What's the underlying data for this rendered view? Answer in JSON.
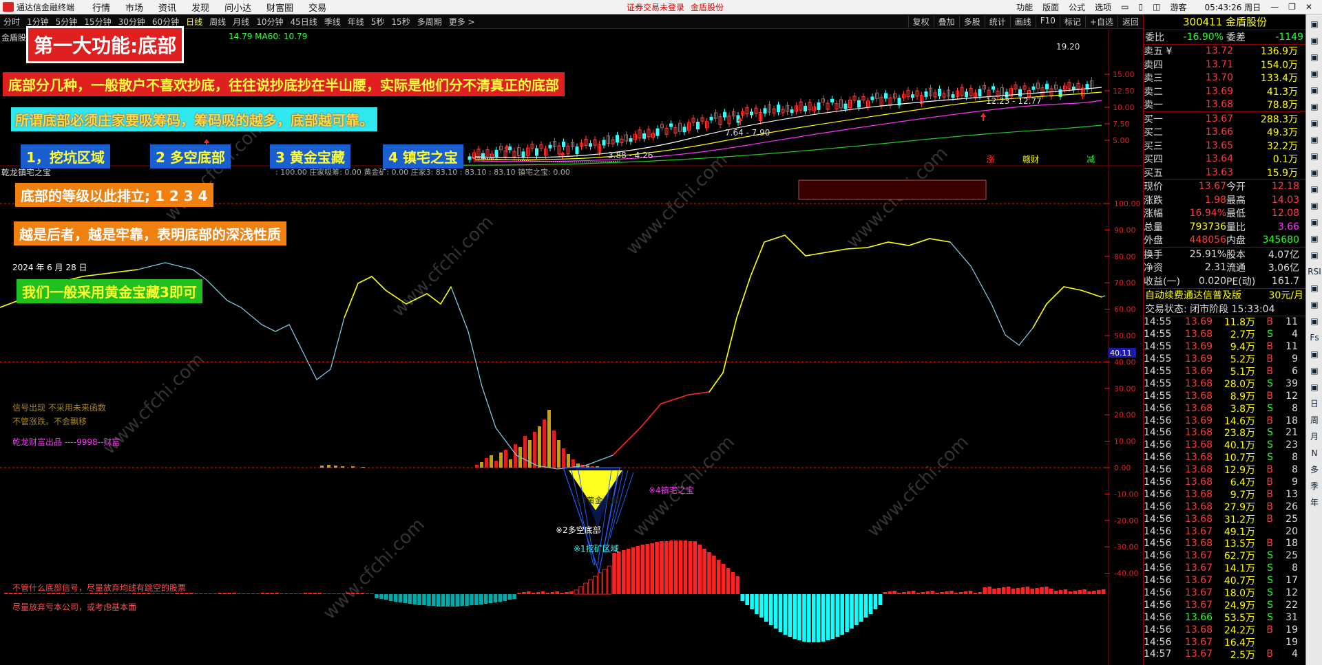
{
  "app": {
    "title": "通达信金融终端",
    "menus": [
      "行情",
      "市场",
      "资讯",
      "发现",
      "问小达",
      "财富圈",
      "交易"
    ],
    "warning": "证券交易未登录",
    "stock_tab": "金盾股份",
    "right_menu": [
      "功能",
      "版面",
      "公式",
      "选项"
    ],
    "user": "游客",
    "clock": "05:43:26 周日"
  },
  "periods": [
    "分时",
    "1分钟",
    "5分钟",
    "15分钟",
    "30分钟",
    "60分钟",
    "日线",
    "周线",
    "月线",
    "10分钟",
    "45日线",
    "季线",
    "年线",
    "5秒",
    "15秒",
    "多周期",
    "更多 >"
  ],
  "active_period": "日线",
  "tools": [
    "复权",
    "叠加",
    "多股",
    "统计",
    "画线",
    "F10",
    "标记",
    "+自选",
    "返回"
  ],
  "main_chart": {
    "stock_label": "金盾股",
    "ma_label": "14.79  MA60: 10.79",
    "price_ticks": [
      "15.00",
      "12.50",
      "10.00",
      "7.50",
      "5.00"
    ],
    "labels": {
      "high": "19.20",
      "range1": "12.23 - 12.77",
      "range2": "7.64 - 7.90",
      "low": "3.88 - 4.26"
    },
    "badges": [
      "涨",
      "赣财",
      "减"
    ]
  },
  "indicator": {
    "name": "乾龙镇宅之宝",
    "values_line": ": 100.00  庄家吸筹: 0.00  黄金矿: 0.00  庄家3: 83.10  : 83.10  : 83.10  镇宅之宝: 0.00",
    "ticks": [
      "100.00",
      "90.00",
      "80.00",
      "70.00",
      "60.00",
      "50.00",
      "40.00",
      "30.00",
      "20.00",
      "10.00",
      "0.00",
      "-10.00",
      "-20.00",
      "-30.00",
      "-40.00"
    ],
    "cursor_value": "40.11",
    "date": "2024 年 6 月 28 日",
    "labels": {
      "gold": "※3黄金宝藏",
      "duokong": "※2多空底部",
      "wakeng": "※1挖矿区域",
      "zhenzhai": "※4镇宅之宝"
    },
    "notes": [
      "信号出现  不采用未来函数",
      "不管涨跌。不会飘移",
      "乾龙财富出品 ----9998--财富"
    ],
    "bottom_notes": [
      "不管什么底部信号，尽量放弃均线有跳空的股票",
      "尽量放弃亏本公司，或考虑基本面"
    ]
  },
  "annotations": {
    "title": "第一大功能:底部",
    "line1": "底部分几种，一般散户不喜欢抄底，往往说抄底抄在半山腰，实际是他们分不清真正的底部",
    "line2": "所谓底部必须庄家要吸筹码，筹码吸的越多，底部越可靠。",
    "b1": "1，挖坑区域",
    "b2": "2 多空底部",
    "b3": "3 黄金宝藏",
    "b4": "4 镇宅之宝",
    "rank": "底部的等级以此排立; 1    2   3   4",
    "deep": "越是后者，越是牢靠，表明底部的深浅性质",
    "use": "我们一般采用黄金宝藏3即可"
  },
  "watermark": "www.cfchi.com",
  "quote": {
    "code_name": "300411 金盾股份",
    "weibi": {
      "label": "委比",
      "value": "-16.90%",
      "label2": "委差",
      "value2": "-1149"
    },
    "sells": [
      {
        "l": "卖五 ¥",
        "p": "13.72",
        "v": "136.9万"
      },
      {
        "l": "卖四",
        "p": "13.71",
        "v": "154.0万"
      },
      {
        "l": "卖三",
        "p": "13.70",
        "v": "133.4万"
      },
      {
        "l": "卖二",
        "p": "13.69",
        "v": "41.3万"
      },
      {
        "l": "卖一",
        "p": "13.68",
        "v": "78.8万"
      }
    ],
    "buys": [
      {
        "l": "买一",
        "p": "13.67",
        "v": "288.3万"
      },
      {
        "l": "买二",
        "p": "13.66",
        "v": "49.3万"
      },
      {
        "l": "买三",
        "p": "13.65",
        "v": "32.2万"
      },
      {
        "l": "买四",
        "p": "13.64",
        "v": "0.1万"
      },
      {
        "l": "买五",
        "p": "13.63",
        "v": "15.9万"
      }
    ],
    "stats": [
      {
        "a": "现价",
        "av": "13.67",
        "b": "今开",
        "bv": "12.18"
      },
      {
        "a": "涨跌",
        "av": "1.98",
        "b": "最高",
        "bv": "14.03"
      },
      {
        "a": "涨幅",
        "av": "16.94%",
        "b": "最低",
        "bv": "12.08"
      },
      {
        "a": "总量",
        "av": "793736",
        "b": "量比",
        "bv": "3.66"
      },
      {
        "a": "外盘",
        "av": "448056",
        "b": "内盘",
        "bv": "345680"
      }
    ],
    "stats2": [
      {
        "a": "换手",
        "av": "25.91%",
        "b": "股本",
        "bv": "4.07亿"
      },
      {
        "a": "净资",
        "av": "2.31",
        "b": "流通",
        "bv": "3.06亿"
      },
      {
        "a": "收益(一)",
        "av": "0.020",
        "b": "PE(动)",
        "bv": "161.7"
      }
    ],
    "promo": "自动续费通达信普及版",
    "promo_price": "30元/月",
    "status": "交易状态: 闭市阶段 15:33:04",
    "ticks": [
      [
        "14:55",
        "13.69",
        "11.8万",
        "B",
        "11"
      ],
      [
        "14:55",
        "13.68",
        "2.7万",
        "S",
        "4"
      ],
      [
        "14:55",
        "13.69",
        "9.4万",
        "B",
        "11"
      ],
      [
        "14:55",
        "13.69",
        "5.2万",
        "B",
        "9"
      ],
      [
        "14:55",
        "13.69",
        "5.1万",
        "B",
        "6"
      ],
      [
        "14:55",
        "13.68",
        "28.0万",
        "S",
        "39"
      ],
      [
        "14:55",
        "13.68",
        "8.9万",
        "B",
        "12"
      ],
      [
        "14:56",
        "13.68",
        "3.8万",
        "S",
        "8"
      ],
      [
        "14:56",
        "13.69",
        "14.6万",
        "B",
        "18"
      ],
      [
        "14:56",
        "13.68",
        "23.8万",
        "S",
        "21"
      ],
      [
        "14:56",
        "13.68",
        "40.1万",
        "S",
        "23"
      ],
      [
        "14:56",
        "13.68",
        "10.7万",
        "S",
        "8"
      ],
      [
        "14:56",
        "13.68",
        "12.9万",
        "B",
        "8"
      ],
      [
        "14:56",
        "13.68",
        "6.4万",
        "B",
        "9"
      ],
      [
        "14:56",
        "13.68",
        "9.7万",
        "B",
        "13"
      ],
      [
        "14:56",
        "13.68",
        "27.9万",
        "B",
        "26"
      ],
      [
        "14:56",
        "13.68",
        "31.2万",
        "B",
        "25"
      ],
      [
        "14:56",
        "13.67",
        "49.1万",
        "",
        "20"
      ],
      [
        "14:56",
        "13.68",
        "13.5万",
        "B",
        "18"
      ],
      [
        "14:56",
        "13.67",
        "62.7万",
        "S",
        "25"
      ],
      [
        "14:56",
        "13.67",
        "14.1万",
        "S",
        "8"
      ],
      [
        "14:56",
        "13.67",
        "40.7万",
        "S",
        "17"
      ],
      [
        "14:56",
        "13.67",
        "18.0万",
        "S",
        "12"
      ],
      [
        "14:56",
        "13.67",
        "24.9万",
        "S",
        "22"
      ],
      [
        "14:56",
        "13.66",
        "53.5万",
        "S",
        "31"
      ],
      [
        "14:56",
        "13.68",
        "24.2万",
        "B",
        "19"
      ],
      [
        "14:56",
        "13.67",
        "16.4万",
        "",
        "19"
      ],
      [
        "14:57",
        "13.67",
        "2.5万",
        "B",
        "4"
      ]
    ]
  },
  "side_tools": [
    "1",
    "2",
    "3",
    "4",
    "5",
    "6",
    "7",
    "8",
    "9",
    "10",
    "11",
    "12",
    "13",
    "14",
    "15",
    "RSI",
    "17",
    "18",
    "19",
    "Fs",
    "21",
    "22",
    "23",
    "日",
    "周",
    "月",
    "N",
    "多",
    "季",
    "年"
  ]
}
